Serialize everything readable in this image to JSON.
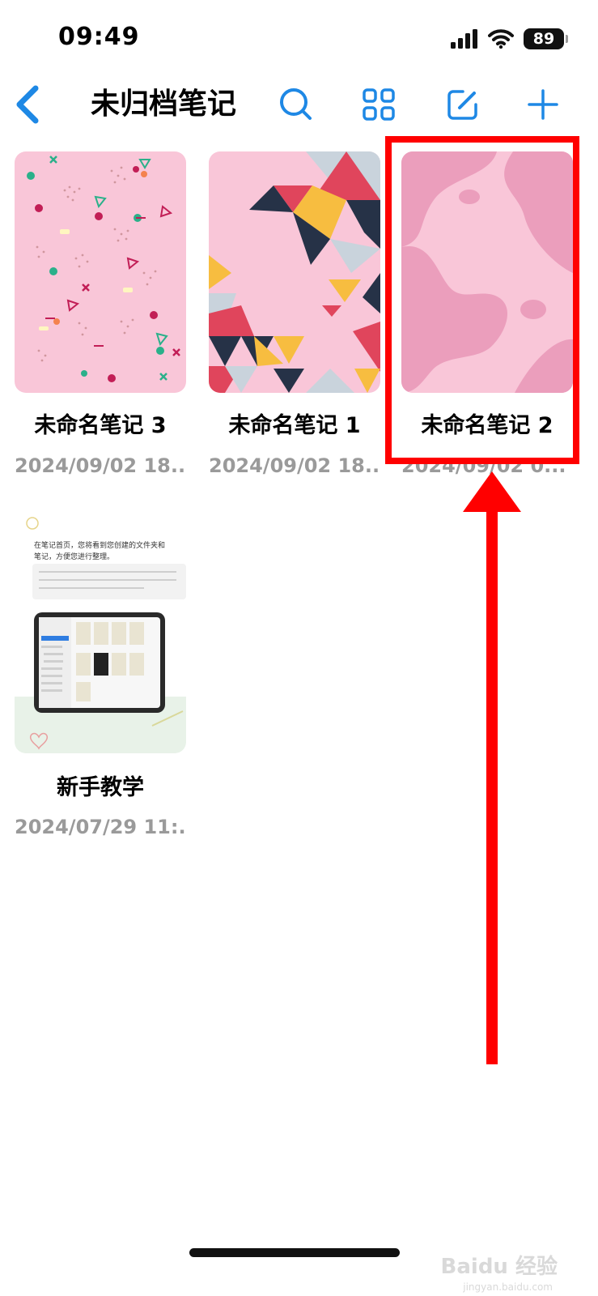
{
  "status": {
    "time": "09:49",
    "battery": "89",
    "icons": [
      "signal-icon",
      "wifi-icon",
      "battery-icon"
    ]
  },
  "nav": {
    "title": "未归档笔记",
    "icons": [
      "back-chevron-icon",
      "search-icon",
      "grid-view-icon",
      "edit-icon",
      "add-icon"
    ],
    "accent_color": "#1e88e5"
  },
  "notes": [
    {
      "title": "未命名笔记 3",
      "date": "2024/09/02 18..."
    },
    {
      "title": "未命名笔记 1",
      "date": "2024/09/02 18..."
    },
    {
      "title": "未命名笔记 2",
      "date": "2024/09/02 0..."
    },
    {
      "title": "新手教学",
      "date": "2024/07/29 11:..."
    }
  ],
  "tutorial_thumb": {
    "line1": "在笔记首页，您将看到您创建的文件夹和",
    "line2": "笔记，方便您进行整理。"
  },
  "annotation": {
    "color": "#ff0000"
  },
  "watermark": {
    "main": "Baidu 经验",
    "sub": "jingyan.baidu.com"
  }
}
